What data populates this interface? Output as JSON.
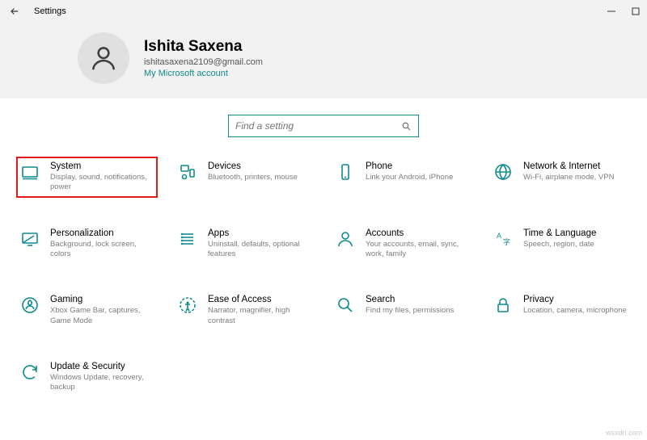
{
  "window": {
    "title": "Settings"
  },
  "user": {
    "name": "Ishita Saxena",
    "email": "ishitasaxena2109@gmail.com",
    "link": "My Microsoft account"
  },
  "search": {
    "placeholder": "Find a setting"
  },
  "tiles": [
    {
      "title": "System",
      "desc": "Display, sound, notifications, power"
    },
    {
      "title": "Devices",
      "desc": "Bluetooth, printers, mouse"
    },
    {
      "title": "Phone",
      "desc": "Link your Android, iPhone"
    },
    {
      "title": "Network & Internet",
      "desc": "Wi-Fi, airplane mode, VPN"
    },
    {
      "title": "Personalization",
      "desc": "Background, lock screen, colors"
    },
    {
      "title": "Apps",
      "desc": "Uninstall, defaults, optional features"
    },
    {
      "title": "Accounts",
      "desc": "Your accounts, email, sync, work, family"
    },
    {
      "title": "Time & Language",
      "desc": "Speech, region, date"
    },
    {
      "title": "Gaming",
      "desc": "Xbox Game Bar, captures, Game Mode"
    },
    {
      "title": "Ease of Access",
      "desc": "Narrator, magnifier, high contrast"
    },
    {
      "title": "Search",
      "desc": "Find my files, permissions"
    },
    {
      "title": "Privacy",
      "desc": "Location, camera, microphone"
    },
    {
      "title": "Update & Security",
      "desc": "Windows Update, recovery, backup"
    }
  ],
  "watermark": "wsxdn.com"
}
